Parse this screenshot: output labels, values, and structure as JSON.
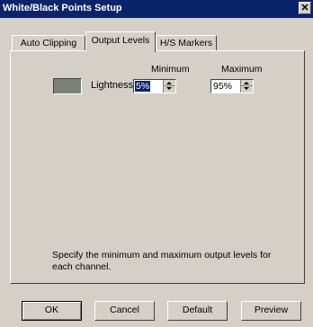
{
  "window": {
    "title": "White/Black Points Setup",
    "close_glyph": "✕"
  },
  "tabs": [
    {
      "label": "Auto Clipping",
      "active": false
    },
    {
      "label": "Output Levels",
      "active": true
    },
    {
      "label": "H/S Markers",
      "active": false
    }
  ],
  "output_levels": {
    "min_header": "Minimum",
    "max_header": "Maximum",
    "row_label": "Lightness :",
    "swatch_color": "#7c807a",
    "minimum_value": "5%",
    "maximum_value": "95%",
    "description": "Specify the minimum and maximum output levels for each channel."
  },
  "buttons": {
    "ok": "OK",
    "cancel": "Cancel",
    "default": "Default",
    "preview": "Preview"
  }
}
